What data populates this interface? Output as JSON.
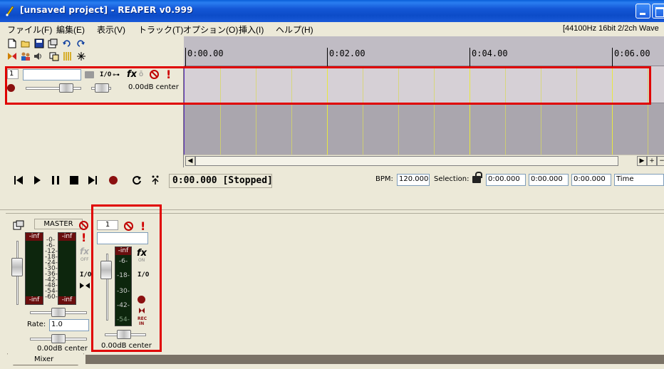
{
  "window": {
    "title": "[unsaved project] - REAPER v0.999"
  },
  "menu": {
    "items": [
      "ファイル(F)",
      "編集(E)",
      "表示(V)",
      "トラック(T)",
      "オプション(O)",
      "挿入(I)",
      "ヘルプ(H)"
    ],
    "audio_info": "[44100Hz 16bit 2/2ch Wave"
  },
  "ruler": {
    "labels": [
      "0:00.00",
      "0:02.00",
      "0:04.00",
      "0:06.00"
    ]
  },
  "track": {
    "number": "1",
    "name": "",
    "io_label": "I/O",
    "fx_label": "fx",
    "volume_text": "0.00dB center"
  },
  "transport": {
    "time": "0:00.000 [Stopped]",
    "bpm_label": "BPM:",
    "bpm_value": "120.000",
    "selection_label": "Selection:",
    "sel_start": "0:00.000",
    "sel_end": "0:00.000",
    "sel_length": "0:00.000",
    "time_mode": "Time"
  },
  "mixer": {
    "tab_label": "Mixer",
    "master": {
      "name": "MASTER",
      "meter_left_top": "-inf",
      "meter_right_top": "-inf",
      "meter_left_bottom": "-inf",
      "meter_right_bottom": "-inf",
      "scale": [
        "-0-",
        "-6-",
        "-12-",
        "-18-",
        "-24-",
        "-30-",
        "-36-",
        "-42-",
        "-48-",
        "-54-",
        "-60-"
      ],
      "fx_label": "fx",
      "fx_state": "OFF",
      "io_label": "I/O",
      "rate_label": "Rate:",
      "rate_value": "1.0",
      "volume_text": "0.00dB center"
    },
    "channel": {
      "number": "1",
      "meter_top": "-inf",
      "scale": [
        "-6-",
        "-18-",
        "-30-",
        "-42-",
        "-54-"
      ],
      "fx_label": "fx",
      "fx_state": "ON",
      "io_label": "I/O",
      "rec_label": "REC",
      "in_label": "IN",
      "volume_text": "0.00dB center"
    }
  },
  "colors": {
    "titlebar": "#1457d6",
    "highlight": "#e00000",
    "record": "#8b1010",
    "gridline": "#e8e840"
  }
}
